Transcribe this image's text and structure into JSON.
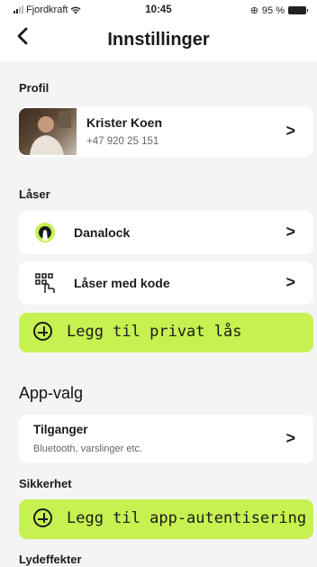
{
  "status_bar": {
    "carrier": "Fjordkraft",
    "time": "10:45",
    "battery": "95 %"
  },
  "nav": {
    "back": "<",
    "title": "Innstillinger"
  },
  "profile": {
    "section_label": "Profil",
    "name": "Krister Koen",
    "phone": "+47 920 25 151"
  },
  "locks": {
    "section_label": "Låser",
    "items": [
      {
        "label": "Danalock",
        "icon": "danalock-logo-icon"
      },
      {
        "label": "Låser med kode",
        "icon": "keypad-code-icon"
      }
    ],
    "add_button": "Legg til privat lås"
  },
  "app_options": {
    "section_label": "App-valg",
    "access": {
      "title": "Tilganger",
      "subtitle": "Bluetooth, varslinger etc."
    },
    "security_label": "Sikkerhet",
    "add_auth_button": "Legg til app-autentisering",
    "sound_label": "Lydeffekter"
  },
  "chevron": ">",
  "colors": {
    "accent": "#c6f150",
    "background": "#f4f4f2",
    "card": "#ffffff"
  }
}
